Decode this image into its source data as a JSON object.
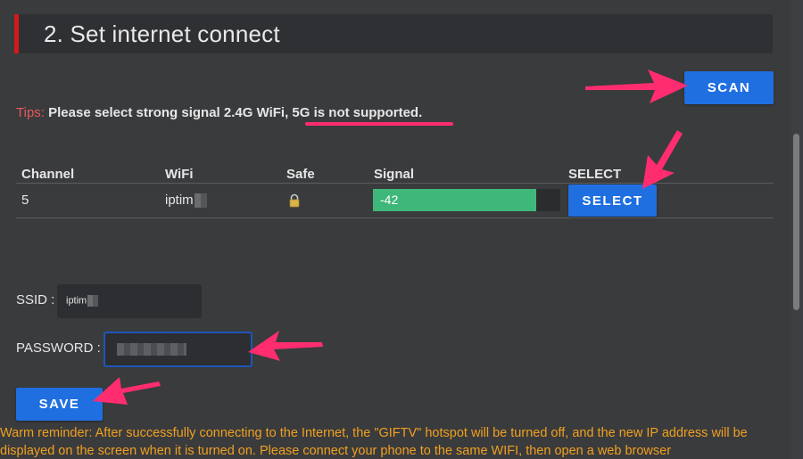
{
  "section": {
    "title": "2. Set internet connect"
  },
  "tips": {
    "label": "Tips:",
    "text_before": "Please select strong signal 2.4G WiFi, ",
    "text_highlight": "5G is not supported."
  },
  "buttons": {
    "scan": "SCAN",
    "select": "SELECT",
    "save": "SAVE"
  },
  "table": {
    "headers": [
      "Channel",
      "WiFi",
      "Safe",
      "Signal",
      "SELECT"
    ],
    "rows": [
      {
        "channel": "5",
        "wifi": "iptim",
        "safe_icon": "lock-icon",
        "signal": "-42",
        "signal_fill_fraction": 0.87
      }
    ]
  },
  "form": {
    "ssid_label": "SSID :",
    "ssid_value": "iptim",
    "password_label": "PASSWORD :"
  },
  "reminder": "Warm reminder: After successfully connecting to the Internet, the \"GIFTV\" hotspot will be turned off, and the new IP address will be displayed on the screen when it is turned on. Please connect your phone to the same WIFI, then open a web browser",
  "colors": {
    "accent": "#1f6fe0",
    "signal": "#40b77a",
    "tips_label": "#e8585a",
    "reminder": "#f0a020",
    "annotation": "#ff2d6f",
    "header_bar": "#d11a1a"
  }
}
